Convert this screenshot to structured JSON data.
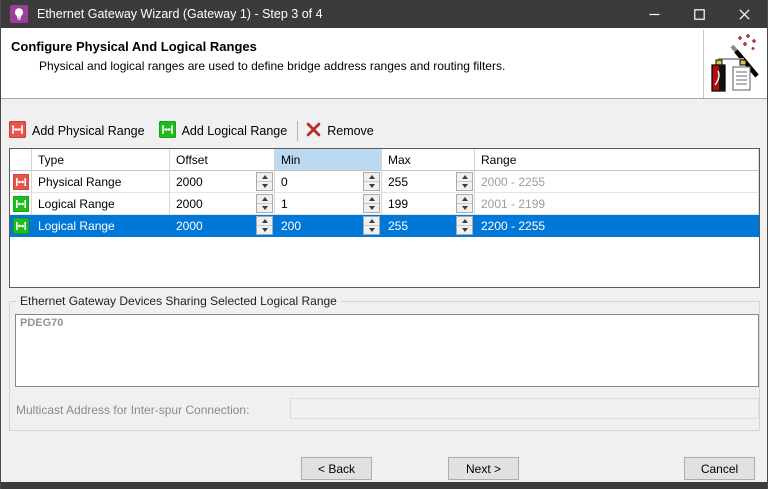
{
  "window": {
    "title": "Ethernet Gateway Wizard (Gateway 1) - Step 3 of 4"
  },
  "header": {
    "title": "Configure Physical And Logical Ranges",
    "description": "Physical and logical ranges are used to define bridge address ranges and routing filters."
  },
  "toolbar": {
    "add_physical_label": "Add Physical Range",
    "add_logical_label": "Add Logical Range",
    "remove_label": "Remove"
  },
  "table": {
    "columns": [
      "Type",
      "Offset",
      "Min",
      "Max",
      "Range"
    ],
    "highlighted_column": "Min",
    "rows": [
      {
        "icon": "physical-range-icon",
        "type": "Physical Range",
        "offset": "2000",
        "min": "0",
        "max": "255",
        "range": "2000 - 2255",
        "selected": false
      },
      {
        "icon": "logical-range-icon",
        "type": "Logical Range",
        "offset": "2000",
        "min": "1",
        "max": "199",
        "range": "2001 - 2199",
        "selected": false
      },
      {
        "icon": "logical-range-icon",
        "type": "Logical Range",
        "offset": "2000",
        "min": "200",
        "max": "255",
        "range": "2200 - 2255",
        "selected": true
      }
    ]
  },
  "group": {
    "label": "Ethernet Gateway Devices Sharing Selected Logical Range",
    "devices_text": "PDEG70",
    "multicast_label": "Multicast Address for Inter-spur Connection:",
    "multicast_value": ""
  },
  "footer": {
    "back_label": "< Back",
    "next_label": "Next >",
    "cancel_label": "Cancel"
  },
  "colors": {
    "titlebar": "#3b3b3b",
    "selected_row": "#0078d7",
    "min_header_highlight": "#bcd9f2",
    "physical_icon": "#e8554a",
    "logical_icon": "#1ebc1e",
    "window_icon": "#9c3e9b",
    "remove_x": "#b92b2b"
  }
}
